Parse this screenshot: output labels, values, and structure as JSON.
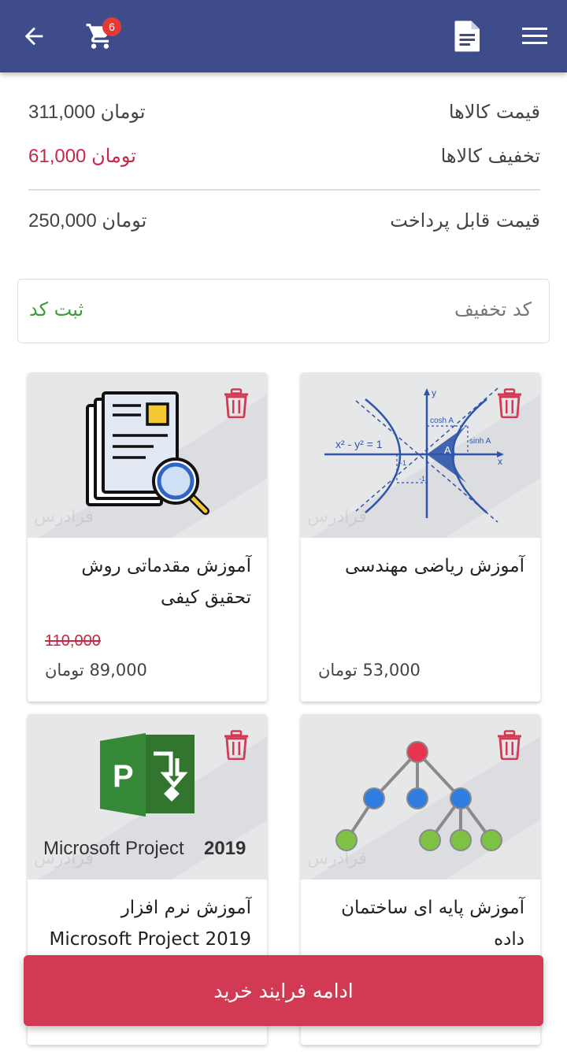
{
  "header": {
    "back_icon": "arrow-left-icon",
    "cart_icon": "cart-icon",
    "cart_badge": "6",
    "doc_icon": "document-icon",
    "menu_icon": "hamburger-menu-icon",
    "bg_color": "#3f4c8c"
  },
  "summary": {
    "items_price_label": "قیمت کالاها",
    "items_price_value": "311,000 تومان",
    "discount_label": "تخفیف کالاها",
    "discount_value": "61,000 تومان",
    "payable_label": "قیمت قابل پرداخت",
    "payable_value": "250,000 تومان"
  },
  "coupon": {
    "placeholder": "کد تخفیف",
    "submit_label": "ثبت کد"
  },
  "products": [
    {
      "title": "آموزش ریاضی مهندسی",
      "old_price": "",
      "price": "53,000 تومان",
      "image": "hyperbola-graph",
      "watermark": "فرادرس"
    },
    {
      "title": "آموزش مقدماتی روش تحقیق کیفی",
      "old_price": "110,000",
      "price": "89,000 تومان",
      "image": "document-search",
      "watermark": "فرادرس"
    },
    {
      "title": "آموزش پایه ای ساختمان داده",
      "old_price": "",
      "price": "",
      "image": "tree-diagram",
      "watermark": "فرادرس"
    },
    {
      "title": "آموزش نرم افزار Microsoft Project 2019",
      "old_price": "",
      "price": "",
      "image": "ms-project-logo",
      "watermark": "فرادرس",
      "logo_text": "Microsoft Project",
      "logo_year": "2019",
      "logo_letter": "P"
    }
  ],
  "graph": {
    "axis_x": "x",
    "axis_y": "y",
    "equation": "x² - y² = 1",
    "cosh": "cosh A",
    "sinh": "sinh A",
    "area": "A",
    "neg_one_a": "-1",
    "neg_one_b": "-1"
  },
  "cta": {
    "label": "ادامه فرایند خرید"
  },
  "colors": {
    "accent_red": "#d23a53",
    "discount_red": "#c62845",
    "green": "#3c9a3c"
  }
}
